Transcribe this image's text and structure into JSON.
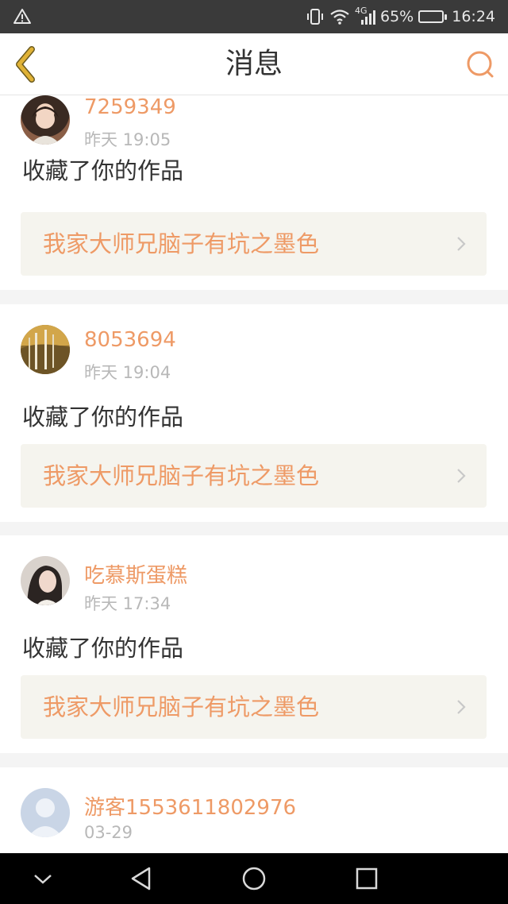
{
  "status_bar": {
    "network": "4G",
    "battery": "65%",
    "battery_level": 0.65,
    "time": "16:24"
  },
  "header": {
    "title": "消息"
  },
  "messages": [
    {
      "username": "7259349",
      "time": "昨天  19:05",
      "action": "收藏了你的作品",
      "work_title": "我家大师兄脑子有坑之墨色"
    },
    {
      "username": "8053694",
      "time": "昨天  19:04",
      "action": "收藏了你的作品",
      "work_title": "我家大师兄脑子有坑之墨色"
    },
    {
      "username": "吃慕斯蛋糕",
      "time": "昨天  17:34",
      "action": "收藏了你的作品",
      "work_title": "我家大师兄脑子有坑之墨色"
    },
    {
      "username": "游客1553611802976",
      "time": "03-29"
    }
  ],
  "colors": {
    "accent": "#ee9a66",
    "back_icon": "#e0b236",
    "card_bg": "#ffffff",
    "work_bg": "#f5f4ee",
    "separator": "#f4f4f4"
  },
  "icons": {
    "back": "chevron-left-icon",
    "search": "search-icon",
    "work_arrow": "chevron-right-icon"
  }
}
